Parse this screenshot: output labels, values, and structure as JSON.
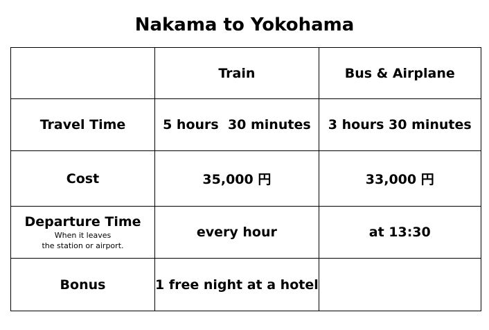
{
  "title": "Nakama to Yokohama",
  "table": {
    "header": {
      "corner": "",
      "col1": "Train",
      "col2": "Bus & Airplane"
    },
    "rows": [
      {
        "label": "Travel Time",
        "note_line1": "",
        "note_line2": "",
        "col1": "5 hours  30 minutes",
        "col2": "3 hours 30 minutes"
      },
      {
        "label": "Cost",
        "note_line1": "",
        "note_line2": "",
        "col1": "35,000 円",
        "col2": "33,000 円"
      },
      {
        "label": "Departure Time",
        "note_line1": "When it leaves",
        "note_line2": "the station or airport.",
        "col1": "every hour",
        "col2": "at 13:30"
      },
      {
        "label": "Bonus",
        "note_line1": "",
        "note_line2": "",
        "col1": "1 free night at a hotel",
        "col2": ""
      }
    ]
  }
}
